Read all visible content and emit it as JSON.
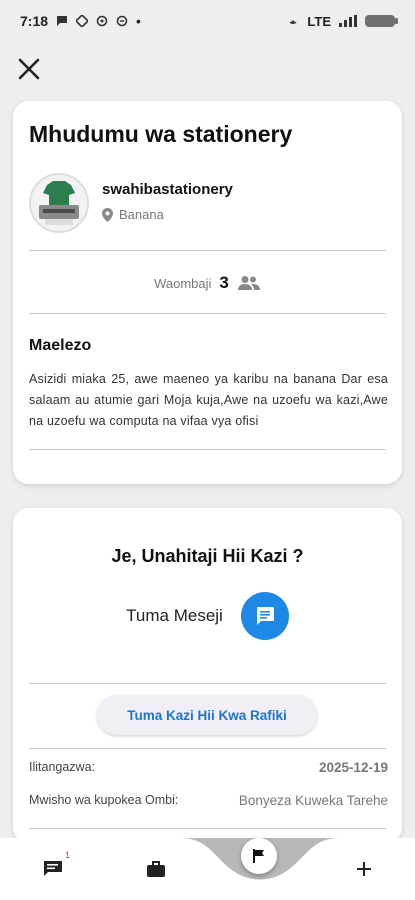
{
  "status_bar": {
    "time": "7:18",
    "dot": "•",
    "network": "LTE"
  },
  "job": {
    "title": "Mhudumu wa stationery",
    "employer": "swahibastationery",
    "location": "Banana",
    "applicants_label": "Waombaji",
    "applicants_count": "3",
    "description_heading": "Maelezo",
    "description": "Asizidi miaka 25, awe maeneo ya karibu na banana Dar esa salaam au atumie gari Moja kuja,Awe na uzoefu wa kazi,Awe na uzoefu wa computa na vifaa vya ofisi"
  },
  "apply": {
    "question": "Je, Unahitaji Hii Kazi ?",
    "message_label": "Tuma Meseji",
    "share_button": "Tuma Kazi Hii Kwa Rafiki",
    "posted_label": "Ilitangazwa:",
    "posted_value": "2025-12-19",
    "deadline_label": "Mwisho wa kupokea Ombi:",
    "deadline_value": "Bonyeza Kuweka Tarehe"
  },
  "nav": {
    "messages_badge": "1"
  },
  "colors": {
    "accent": "#1e88e5",
    "share_text": "#1976d2",
    "background": "#eeeeef"
  }
}
